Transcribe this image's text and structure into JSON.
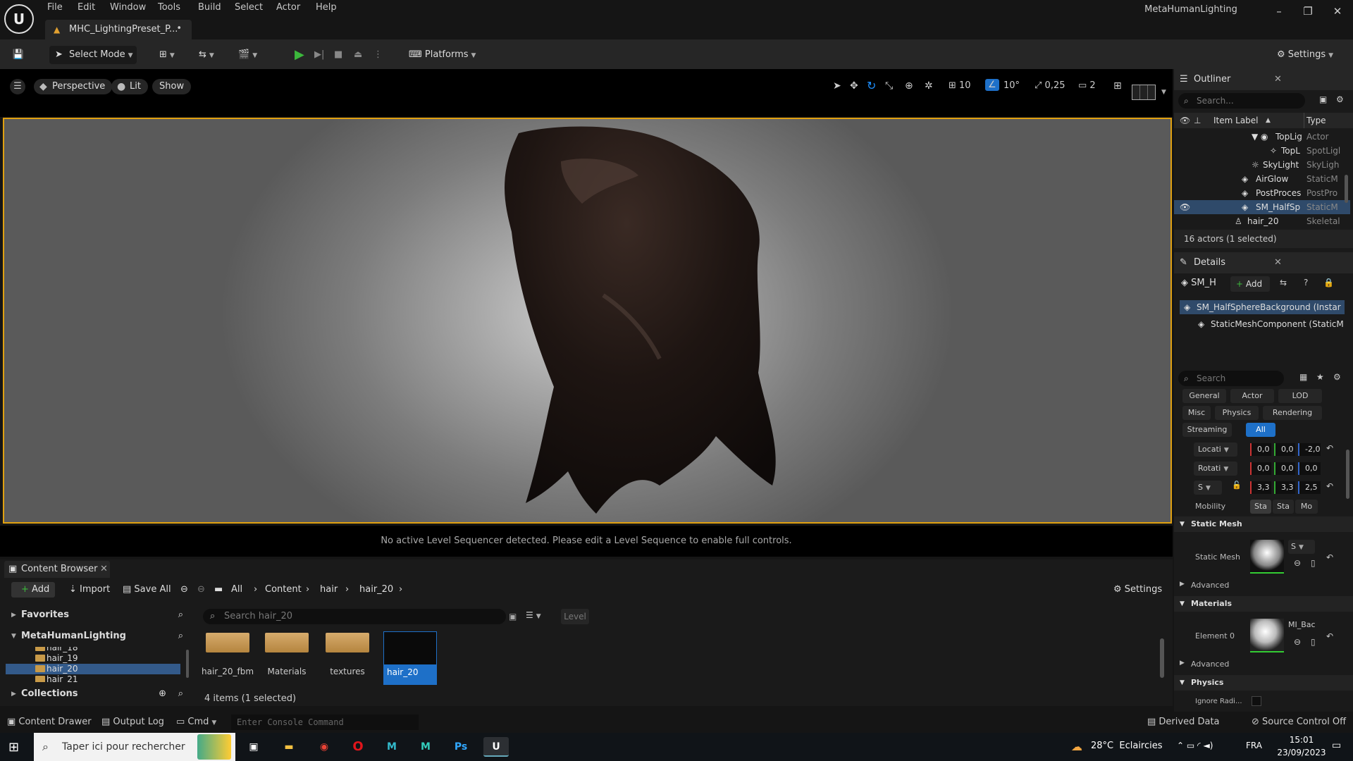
{
  "app": {
    "logo": "U",
    "project": "MetaHumanLighting",
    "tab": "MHC_LightingPreset_P...",
    "dirty": "•"
  },
  "menu": [
    "File",
    "Edit",
    "Window",
    "Tools",
    "Build",
    "Select",
    "Actor",
    "Help"
  ],
  "toolbar": {
    "select_mode": "Select Mode",
    "platforms": "Platforms",
    "settings": "Settings"
  },
  "viewport": {
    "perspective": "Perspective",
    "lit": "Lit",
    "show": "Show",
    "grid": "10",
    "angle": "10°",
    "scale": "0,25",
    "camera": "2",
    "sequencer_msg": "No active Level Sequencer detected. Please edit a Level Sequence to enable full controls."
  },
  "outliner": {
    "title": "Outliner",
    "search": "Search...",
    "col_label": "Item Label",
    "col_type": "Type",
    "rows": [
      {
        "label": "TopLig",
        "type": "Actor"
      },
      {
        "label": "TopL",
        "type": "SpotLigl"
      },
      {
        "label": "SkyLight",
        "type": "SkyLigh"
      },
      {
        "label": "AirGlow",
        "type": "StaticM"
      },
      {
        "label": "PostProces",
        "type": "PostPro"
      },
      {
        "label": "SM_HalfSp",
        "type": "StaticM"
      },
      {
        "label": "hair_20",
        "type": "Skeletal"
      }
    ],
    "status": "16 actors (1 selected)"
  },
  "details": {
    "title": "Details",
    "actor": "SM_H",
    "add": "Add",
    "instance": "SM_HalfSphereBackground (Instar",
    "component": "StaticMeshComponent (StaticM",
    "search": "Search",
    "filters": [
      "General",
      "Actor",
      "LOD",
      "Misc",
      "Physics",
      "Rendering",
      "Streaming",
      "All"
    ],
    "location": {
      "label": "Locati",
      "x": "0,0",
      "y": "0,0",
      "z": "-2,0"
    },
    "rotation": {
      "label": "Rotati",
      "x": "0,0",
      "y": "0,0",
      "z": "0,0"
    },
    "scale": {
      "label": "S",
      "x": "3,3",
      "y": "3,3",
      "z": "2,5"
    },
    "mobility": {
      "label": "Mobility",
      "opts": [
        "Sta",
        "Sta",
        "Mo"
      ]
    },
    "static_mesh": {
      "section": "Static Mesh",
      "label": "Static Mesh",
      "value": "S"
    },
    "advanced": "Advanced",
    "materials": {
      "section": "Materials",
      "label": "Element 0",
      "value": "MI_Bac"
    },
    "physics": {
      "section": "Physics",
      "label": "Ignore Radi..."
    }
  },
  "content_browser": {
    "tab": "Content Browser",
    "add": "Add",
    "import": "Import",
    "save_all": "Save All",
    "path": [
      "All",
      "Content",
      "hair",
      "hair_20"
    ],
    "settings": "Settings",
    "favorites": "Favorites",
    "project": "MetaHumanLighting",
    "collections": "Collections",
    "tree": [
      "hair_18",
      "hair_19",
      "hair_20",
      "hair_21"
    ],
    "search": "Search hair_20",
    "level": "Level",
    "assets": [
      "hair_20_fbm",
      "Materials",
      "textures",
      "hair_20"
    ],
    "count": "4 items (1 selected)"
  },
  "statusbar": {
    "drawer": "Content Drawer",
    "output": "Output Log",
    "cmd": "Cmd",
    "console": "Enter Console Command",
    "derived": "Derived Data",
    "source": "Source Control Off"
  },
  "taskbar": {
    "search": "Taper ici pour rechercher",
    "weather": "28°C  Eclaircies",
    "lang": "FRA",
    "time": "15:01",
    "date": "23/09/2023"
  }
}
